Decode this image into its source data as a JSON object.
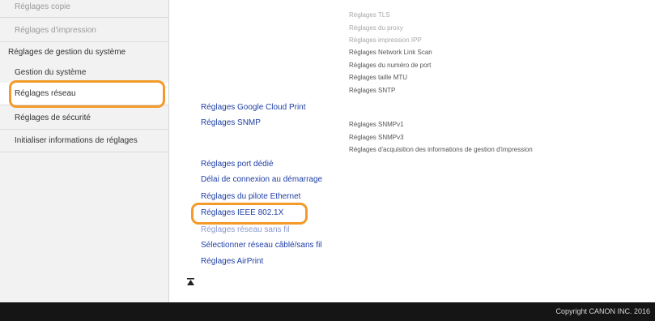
{
  "sidebar": {
    "items": [
      {
        "label": "Réglages copie"
      },
      {
        "label": "Réglages d'impression"
      },
      {
        "label": "Réglages de gestion du système"
      },
      {
        "label": "Gestion du système"
      },
      {
        "label": "Réglages réseau"
      },
      {
        "label": "Réglages de sécurité"
      },
      {
        "label": "Initialiser informations de réglages"
      }
    ]
  },
  "right_info": {
    "group1": [
      "Réglages TLS",
      "Réglages du proxy",
      "Réglages impression IPP",
      "Réglages Network Link Scan",
      "Réglages du numéro de port",
      "Réglages taille MTU",
      "Réglages SNTP"
    ],
    "group2": [
      "Réglages SNMPv1",
      "Réglages SNMPv3",
      "Réglages d'acquisition des informations de gestion d'impression"
    ]
  },
  "main": {
    "links_a": [
      "Réglages Google Cloud Print",
      "Réglages SNMP"
    ],
    "links_b": [
      "Réglages port dédié",
      "Délai de connexion au démarrage",
      "Réglages du pilote Ethernet",
      "Réglages IEEE 802.1X",
      "Réglages réseau sans fil",
      "Sélectionner réseau câblé/sans fil",
      "Réglages AirPrint"
    ]
  },
  "footer": {
    "copyright": "Copyright CANON INC. 2016"
  },
  "icons": {
    "top": "back-to-top-icon"
  },
  "colors": {
    "highlight": "#f39a2a",
    "link": "#1f3fa5",
    "footer_bg": "#151515"
  }
}
